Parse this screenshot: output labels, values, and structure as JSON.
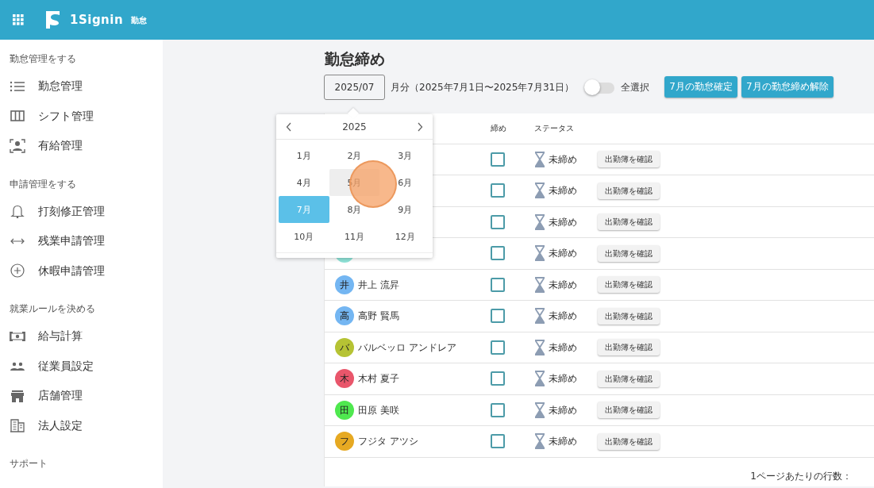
{
  "header": {
    "app_name": "1Signin",
    "module": "勤怠"
  },
  "sidebar": {
    "sections": [
      {
        "title": "勤怠管理をする",
        "items": [
          {
            "label": "勤怠管理"
          },
          {
            "label": "シフト管理"
          },
          {
            "label": "有給管理"
          }
        ]
      },
      {
        "title": "申請管理をする",
        "items": [
          {
            "label": "打刻修正管理"
          },
          {
            "label": "残業申請管理"
          },
          {
            "label": "休暇申請管理"
          }
        ]
      },
      {
        "title": "就業ルールを決める",
        "items": [
          {
            "label": "給与計算"
          },
          {
            "label": "従業員設定"
          },
          {
            "label": "店舗管理"
          },
          {
            "label": "法人設定"
          }
        ]
      },
      {
        "title": "サポート"
      }
    ]
  },
  "page": {
    "title": "勤怠締め",
    "month_field": {
      "value": "2025/07"
    },
    "period": "月分（2025年7月1日〜2025年7月31日）",
    "select_all": {
      "label": "全選択",
      "on": false
    },
    "buttons": [
      "7月の勤怠確定",
      "7月の勤怠締め解除"
    ]
  },
  "month_picker": {
    "year": "2025",
    "months": [
      {
        "label": "1月",
        "selected": false,
        "hovered": false
      },
      {
        "label": "2月",
        "selected": false,
        "hovered": false
      },
      {
        "label": "3月",
        "selected": false,
        "hovered": false
      },
      {
        "label": "4月",
        "selected": false,
        "hovered": false
      },
      {
        "label": "5月",
        "selected": false,
        "hovered": true
      },
      {
        "label": "6月",
        "selected": false,
        "hovered": false
      },
      {
        "label": "7月",
        "selected": true,
        "hovered": false
      },
      {
        "label": "8月",
        "selected": false,
        "hovered": false
      },
      {
        "label": "9月",
        "selected": false,
        "hovered": false
      },
      {
        "label": "10月",
        "selected": false,
        "hovered": false
      },
      {
        "label": "11月",
        "selected": false,
        "hovered": false
      },
      {
        "label": "12月",
        "selected": false,
        "hovered": false
      }
    ]
  },
  "table": {
    "closing_header": "締め",
    "status_header": "ステータス",
    "rows": [
      {
        "checked": false,
        "status": "未締め",
        "action": "出勤簿を確認"
      },
      {
        "checked": false,
        "status": "未締め",
        "action": "出勤簿を確認"
      },
      {
        "checked": false,
        "status": "未締め",
        "action": "出勤簿を確認"
      },
      {
        "avatar": {
          "color": "#8fe3d8"
        },
        "checked": false,
        "status": "未締め",
        "action": "出勤簿を確認"
      },
      {
        "avatar": {
          "initial": "井",
          "color": "#74b6f2"
        },
        "name": "井上 流昇",
        "checked": false,
        "status": "未締め",
        "action": "出勤簿を確認"
      },
      {
        "avatar": {
          "initial": "高",
          "color": "#74b6f2"
        },
        "name": "高野 賢馬",
        "checked": false,
        "status": "未締め",
        "action": "出勤簿を確認"
      },
      {
        "avatar": {
          "initial": "バ",
          "color": "#b6c334"
        },
        "name": "バルベッロ アンドレア",
        "checked": false,
        "status": "未締め",
        "action": "出勤簿を確認"
      },
      {
        "avatar": {
          "initial": "木",
          "color": "#e9566b"
        },
        "name": "木村 夏子",
        "checked": false,
        "status": "未締め",
        "action": "出勤簿を確認"
      },
      {
        "avatar": {
          "initial": "田",
          "color": "#4fe84f"
        },
        "name": "田原 美咲",
        "checked": false,
        "status": "未締め",
        "action": "出勤簿を確認"
      },
      {
        "avatar": {
          "initial": "フ",
          "color": "#e6a922"
        },
        "name": "フジタ アツシ",
        "checked": false,
        "status": "未締め",
        "action": "出勤簿を確認"
      }
    ]
  },
  "footer": {
    "rows_per_page_label": "1ページあたりの行数："
  },
  "click_indicator": {
    "visible": true
  }
}
